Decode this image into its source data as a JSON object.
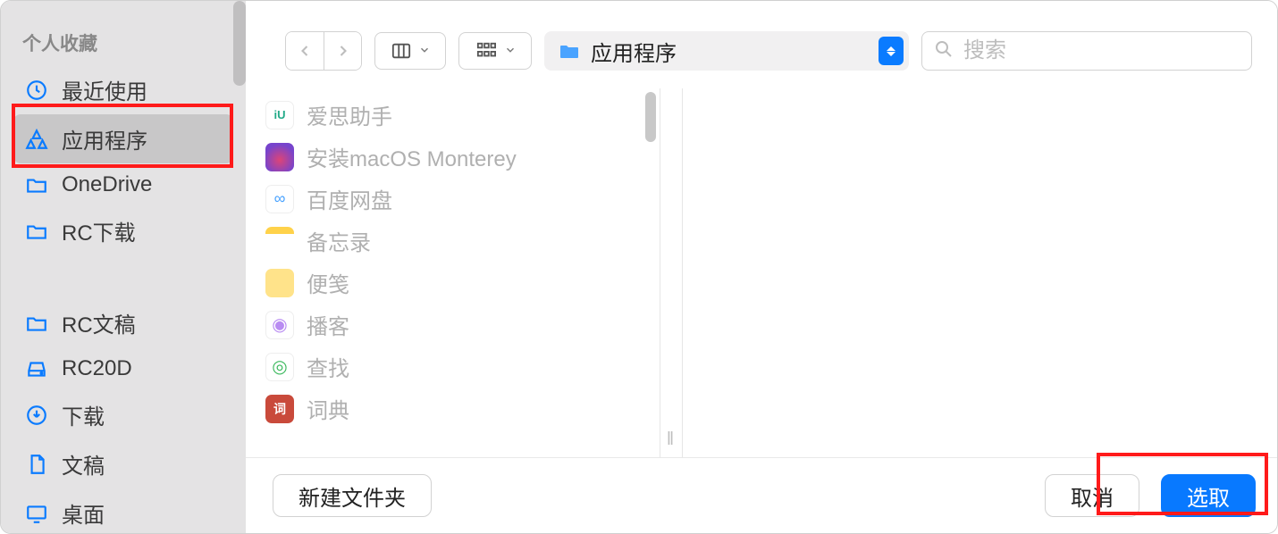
{
  "sidebar": {
    "section_title": "个人收藏",
    "items": [
      {
        "label": "最近使用",
        "icon": "clock"
      },
      {
        "label": "应用程序",
        "icon": "apps",
        "selected": true
      },
      {
        "label": "OneDrive",
        "icon": "folder"
      },
      {
        "label": "RC下载",
        "icon": "folder"
      }
    ],
    "items2": [
      {
        "label": "RC文稿",
        "icon": "folder"
      },
      {
        "label": "RC20D",
        "icon": "disk"
      },
      {
        "label": "下载",
        "icon": "download"
      },
      {
        "label": "文稿",
        "icon": "document"
      },
      {
        "label": "桌面",
        "icon": "desktop"
      }
    ]
  },
  "toolbar": {
    "location": "应用程序",
    "search_placeholder": "搜索"
  },
  "files": [
    {
      "label": "爱思助手",
      "icon_text": "iU",
      "icon_class": "ic-white",
      "icon_color": "#2a8"
    },
    {
      "label": "安装macOS Monterey",
      "icon_text": "",
      "icon_class": "ic-white"
    },
    {
      "label": "百度网盘",
      "icon_text": "∞",
      "icon_class": "ic-white",
      "icon_color": "#4aa3ff"
    },
    {
      "label": "备忘录",
      "icon_text": "",
      "icon_class": "ic-white"
    },
    {
      "label": "便笺",
      "icon_text": "",
      "icon_class": "ic-yellow"
    },
    {
      "label": "播客",
      "icon_text": "◉",
      "icon_class": "ic-white",
      "icon_color": "#b98cf2"
    },
    {
      "label": "查找",
      "icon_text": "◎",
      "icon_class": "ic-white",
      "icon_color": "#7ad28a"
    },
    {
      "label": "词典",
      "icon_text": "词",
      "icon_class": "ic-red"
    }
  ],
  "footer": {
    "new_folder": "新建文件夹",
    "cancel": "取消",
    "choose": "选取"
  }
}
